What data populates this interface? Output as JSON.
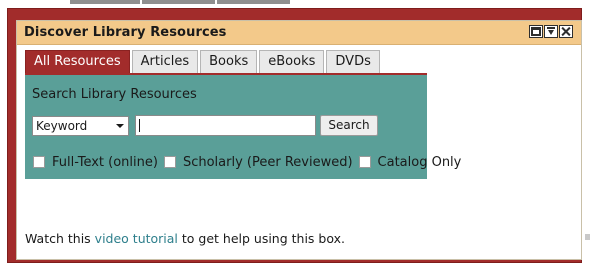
{
  "widget": {
    "title": "Discover Library Resources",
    "window_buttons": [
      {
        "icon": "restore-icon"
      },
      {
        "icon": "dock-icon"
      },
      {
        "icon": "close-icon"
      }
    ]
  },
  "tabs": [
    {
      "label": "All Resources",
      "active": true
    },
    {
      "label": "Articles",
      "active": false
    },
    {
      "label": "Books",
      "active": false
    },
    {
      "label": "eBooks",
      "active": false
    },
    {
      "label": "DVDs",
      "active": false
    }
  ],
  "search": {
    "heading": "Search Library Resources",
    "field_select": "Keyword",
    "query_value": "",
    "button_label": "Search"
  },
  "filters": [
    {
      "label": "Full-Text (online)",
      "checked": false
    },
    {
      "label": "Scholarly (Peer Reviewed)",
      "checked": false
    },
    {
      "label": "Catalog Only",
      "checked": false
    }
  ],
  "help": {
    "before": "Watch this ",
    "link_text": "video tutorial",
    "after": " to get help using this box."
  },
  "colors": {
    "frame": "#a22c2b",
    "titlebar": "#f3c98a",
    "panel": "#5a9f98",
    "active_tab": "#a22c2b",
    "link": "#2e7f8c"
  }
}
